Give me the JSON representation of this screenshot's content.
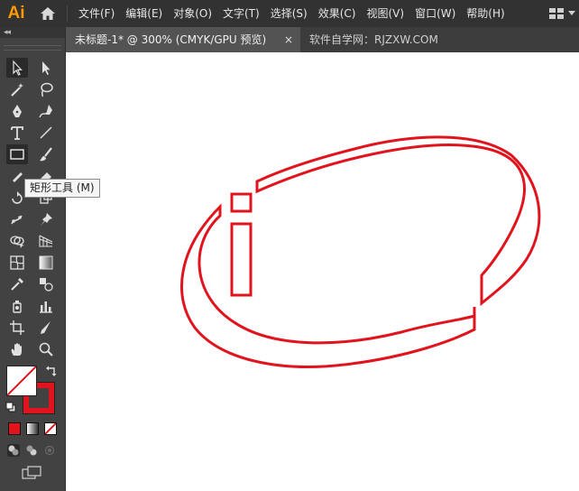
{
  "app": {
    "logo": "Ai"
  },
  "menu": [
    "文件(F)",
    "编辑(E)",
    "对象(O)",
    "文字(T)",
    "选择(S)",
    "效果(C)",
    "视图(V)",
    "窗口(W)",
    "帮助(H)"
  ],
  "toolbar": {
    "collapse_label": "◂◂",
    "tooltip": "矩形工具 (M)",
    "active_tool": "rectangle-tool",
    "fill_color": "#ffffff",
    "stroke_color": "#e1141e"
  },
  "tabs": {
    "active": "未标题-1* @ 300% (CMYK/GPU 预览)",
    "close": "×",
    "second": "软件自学网：RJZXW.COM"
  },
  "artwork": {
    "stroke_color": "#e1141e",
    "shapes": [
      "outer-ring",
      "letter-i-dot",
      "letter-i-stem"
    ]
  }
}
